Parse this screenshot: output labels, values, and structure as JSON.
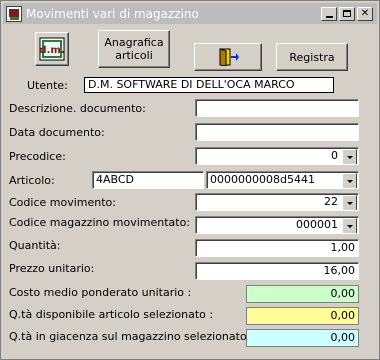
{
  "window": {
    "title": "Movimenti vari di magazzino",
    "title_bar_color": "#BCBCBC"
  },
  "toolbar": {
    "logo_text": "d.m.",
    "anagrafica_label": "Anagrafica articoli",
    "exit_icon": "door-exit-icon",
    "registra_label": "Registra"
  },
  "utente": {
    "label": "Utente:",
    "value": "D.M. SOFTWARE DI DELL'OCA MARCO"
  },
  "form": {
    "descrizione_label": "Descrizione. documento:",
    "descrizione_value": "",
    "data_label": "Data documento:",
    "data_value": "",
    "precodice_label": "Precodice:",
    "precodice_value": "0",
    "articolo_label": "Articolo:",
    "articolo_code": "4ABCD",
    "articolo_id": "0000000008d5441",
    "codice_movimento_label": "Codice movimento:",
    "codice_movimento_value": "22",
    "codice_magazzino_label": "Codice magazzino movimentato:",
    "codice_magazzino_value": "000001",
    "quantita_label": "Quantità:",
    "quantita_value": "1,00",
    "prezzo_label": "Prezzo unitario:",
    "prezzo_value": "16,00"
  },
  "outputs": {
    "costo_label": "Costo medio ponderato unitario :",
    "costo_value": "0,00",
    "costo_color": "#CCFFCC",
    "disponibile_label": "Q.tà disponibile articolo selezionato :",
    "disponibile_value": "0,00",
    "disponibile_color": "#FFFF99",
    "giacenza_label": "Q.tà in giacenza sul magazzino selezionato :",
    "giacenza_value": "0,00",
    "giacenza_color": "#CCFFFF"
  }
}
